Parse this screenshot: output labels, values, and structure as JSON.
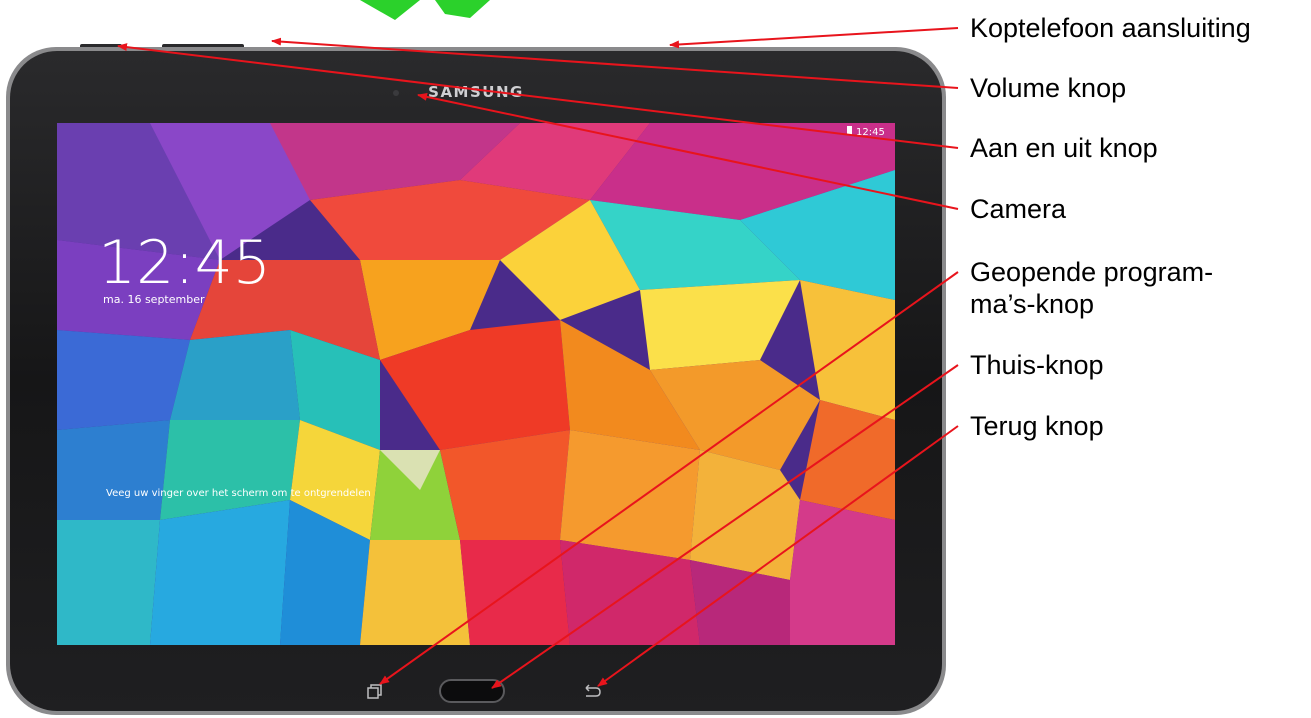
{
  "tablet": {
    "brand": "SAMSUNG",
    "status_time": "12:45",
    "lock_time": "12:45",
    "lock_date": "ma. 16 september",
    "unlock_hint": "Veeg uw vinger over het scherm om te ontgrendelen"
  },
  "callouts": {
    "koptelefoon": "Koptelefoon aansluiting",
    "volume": "Volume knop",
    "aan_uit": "Aan en uit knop",
    "camera": "Camera",
    "geopende_line1": "Geopende program-",
    "geopende_line2": "ma’s-knop",
    "thuis": "Thuis-knop",
    "terug": "Terug knop"
  },
  "colors": {
    "arrow": "#e8141c",
    "bezel": "#1b1b1d",
    "logo_green": "#2bd12b"
  }
}
